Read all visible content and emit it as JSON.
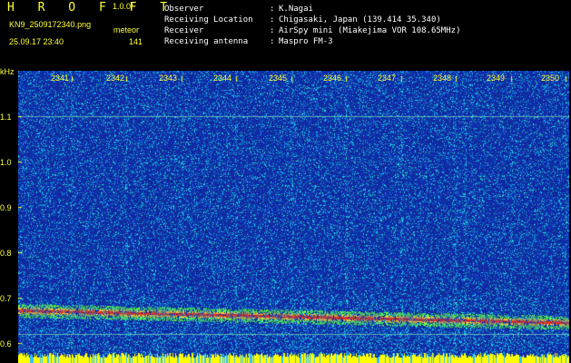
{
  "header": {
    "logo": "H R O F F T",
    "version": "1.0.0f",
    "file_name": "KN9_2509172340.png",
    "mode": "meteor",
    "timestamp": "25.09.17 23:40",
    "count": "141",
    "info": [
      {
        "label": "Observer",
        "value": "K.Nagai"
      },
      {
        "label": "Receiving Location",
        "value": "Chigasaki, Japan (139.414 35.340)"
      },
      {
        "label": "Receiver",
        "value": "AirSpy mini (Miakejima VOR 108.65MHz)"
      },
      {
        "label": "Receiving antenna",
        "value": "Maspro FM-3"
      }
    ],
    "separator": ":"
  },
  "chart_data": {
    "type": "heatmap",
    "ylabel": "kHz",
    "y_ticks": [
      "1.1",
      "1.0",
      "0.9",
      "0.8",
      "0.7",
      "0.6"
    ],
    "x_ticks": [
      "2341",
      "2342",
      "2343",
      "2344",
      "2345",
      "2346",
      "2347",
      "2348",
      "2349",
      "2350"
    ],
    "signal_trace": [
      {
        "time": "2340",
        "khz": 0.672
      },
      {
        "time": "2350",
        "khz": 0.645
      }
    ],
    "carrier_lines_khz": [
      1.1,
      0.62
    ],
    "colors": {
      "background": "#1030a0",
      "noise": "#20c8e8",
      "trace": "#ff3010",
      "trace_halo": "#60ff40",
      "text": "#ffff33",
      "bottom_bar": "#ffff00"
    }
  }
}
